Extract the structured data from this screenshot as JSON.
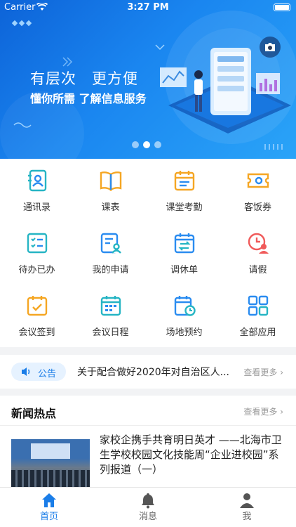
{
  "status_bar": {
    "carrier": "Carrier",
    "time": "3:27 PM"
  },
  "banner": {
    "headline_left": "有层次",
    "headline_right": "更方便",
    "subtitle": "懂你所需 了解信息服务",
    "carousel": {
      "total": 3,
      "active_index": 1
    }
  },
  "grid": [
    {
      "label": "通讯录",
      "icon": "contacts-icon"
    },
    {
      "label": "课表",
      "icon": "book-icon"
    },
    {
      "label": "课堂考勤",
      "icon": "attendance-calendar-icon"
    },
    {
      "label": "客饭券",
      "icon": "meal-ticket-icon"
    },
    {
      "label": "待办已办",
      "icon": "todo-checklist-icon"
    },
    {
      "label": "我的申请",
      "icon": "application-form-icon"
    },
    {
      "label": "调休单",
      "icon": "shift-swap-icon"
    },
    {
      "label": "请假",
      "icon": "leave-clock-icon"
    },
    {
      "label": "会议签到",
      "icon": "meeting-checkin-icon"
    },
    {
      "label": "会议日程",
      "icon": "meeting-schedule-icon"
    },
    {
      "label": "场地预约",
      "icon": "venue-booking-icon"
    },
    {
      "label": "全部应用",
      "icon": "all-apps-icon"
    }
  ],
  "notice": {
    "tag": "公告",
    "text": "关于配合做好2020年对自治区人...",
    "more": "查看更多 ›"
  },
  "news": {
    "heading": "新闻热点",
    "more": "查看更多 ›",
    "items": [
      {
        "title": "家校企携手共育明日英才 ——北海市卫生学校校园文化技能周“企业进校园”系列报道（一）"
      }
    ]
  },
  "tabbar": [
    {
      "label": "首页",
      "icon": "home-icon",
      "active": true
    },
    {
      "label": "消息",
      "icon": "bell-icon",
      "active": false
    },
    {
      "label": "我",
      "icon": "person-icon",
      "active": false
    }
  ],
  "colors": {
    "accent": "#1a7de8",
    "icon_blue": "#2a8cf0",
    "icon_orange": "#f5a623",
    "icon_teal": "#26b5c4",
    "icon_red": "#f05a5a"
  }
}
